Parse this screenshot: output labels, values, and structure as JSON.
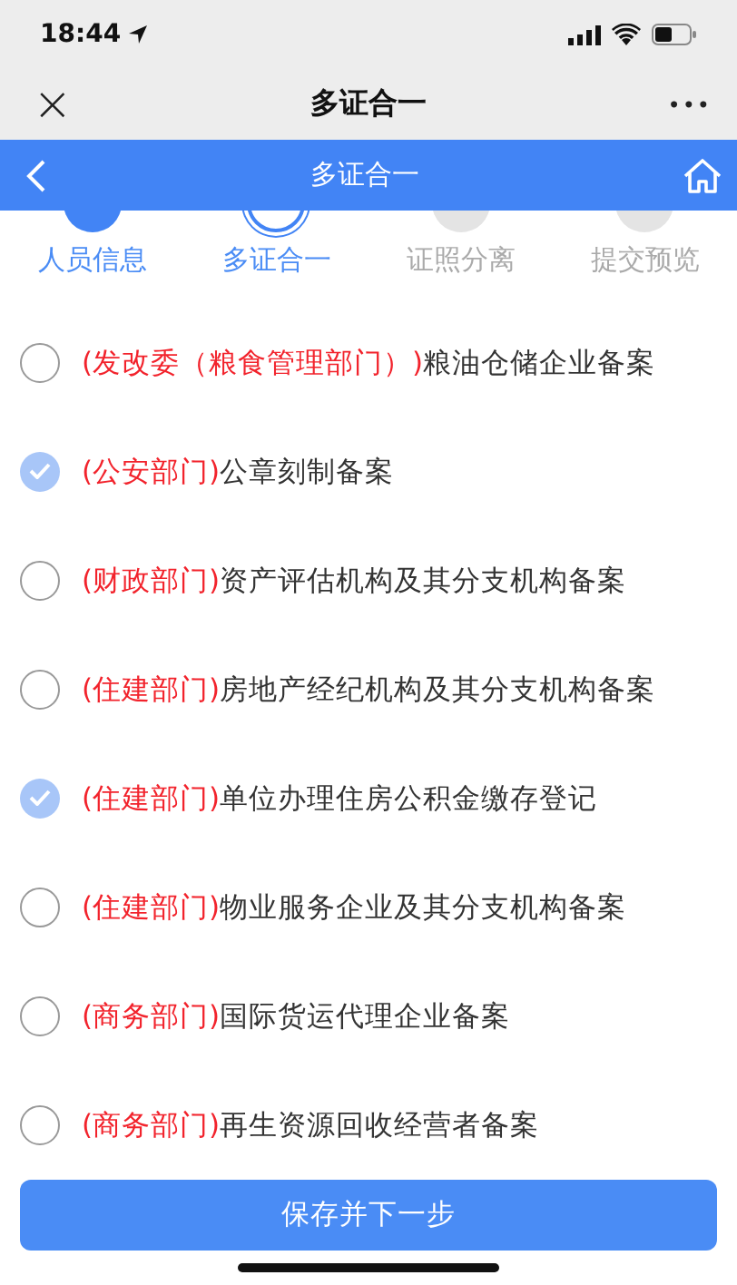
{
  "status_bar": {
    "time": "18:44"
  },
  "mini_program_bar": {
    "title": "多证合一",
    "close": "×",
    "more": "•••"
  },
  "header": {
    "title": "多证合一"
  },
  "steps": [
    {
      "label": "人员信息",
      "kind": "done"
    },
    {
      "label": "多证合一",
      "kind": "current"
    },
    {
      "label": "证照分离",
      "kind": "pending"
    },
    {
      "label": "提交预览",
      "kind": "pending"
    }
  ],
  "items": [
    {
      "department": "(发改委（粮食管理部门）)",
      "name": "粮油仓储企业备案",
      "checked": false
    },
    {
      "department": "(公安部门)",
      "name": "公章刻制备案",
      "checked": true
    },
    {
      "department": "(财政部门)",
      "name": "资产评估机构及其分支机构备案",
      "checked": false
    },
    {
      "department": "(住建部门)",
      "name": "房地产经纪机构及其分支机构备案",
      "checked": false
    },
    {
      "department": "(住建部门)",
      "name": "单位办理住房公积金缴存登记",
      "checked": true
    },
    {
      "department": "(住建部门)",
      "name": "物业服务企业及其分支机构备案",
      "checked": false
    },
    {
      "department": "(商务部门)",
      "name": "国际货运代理企业备案",
      "checked": false
    },
    {
      "department": "(商务部门)",
      "name": "再生资源回收经营者备案",
      "checked": false
    }
  ],
  "save_button": {
    "label": "保存并下一步"
  }
}
